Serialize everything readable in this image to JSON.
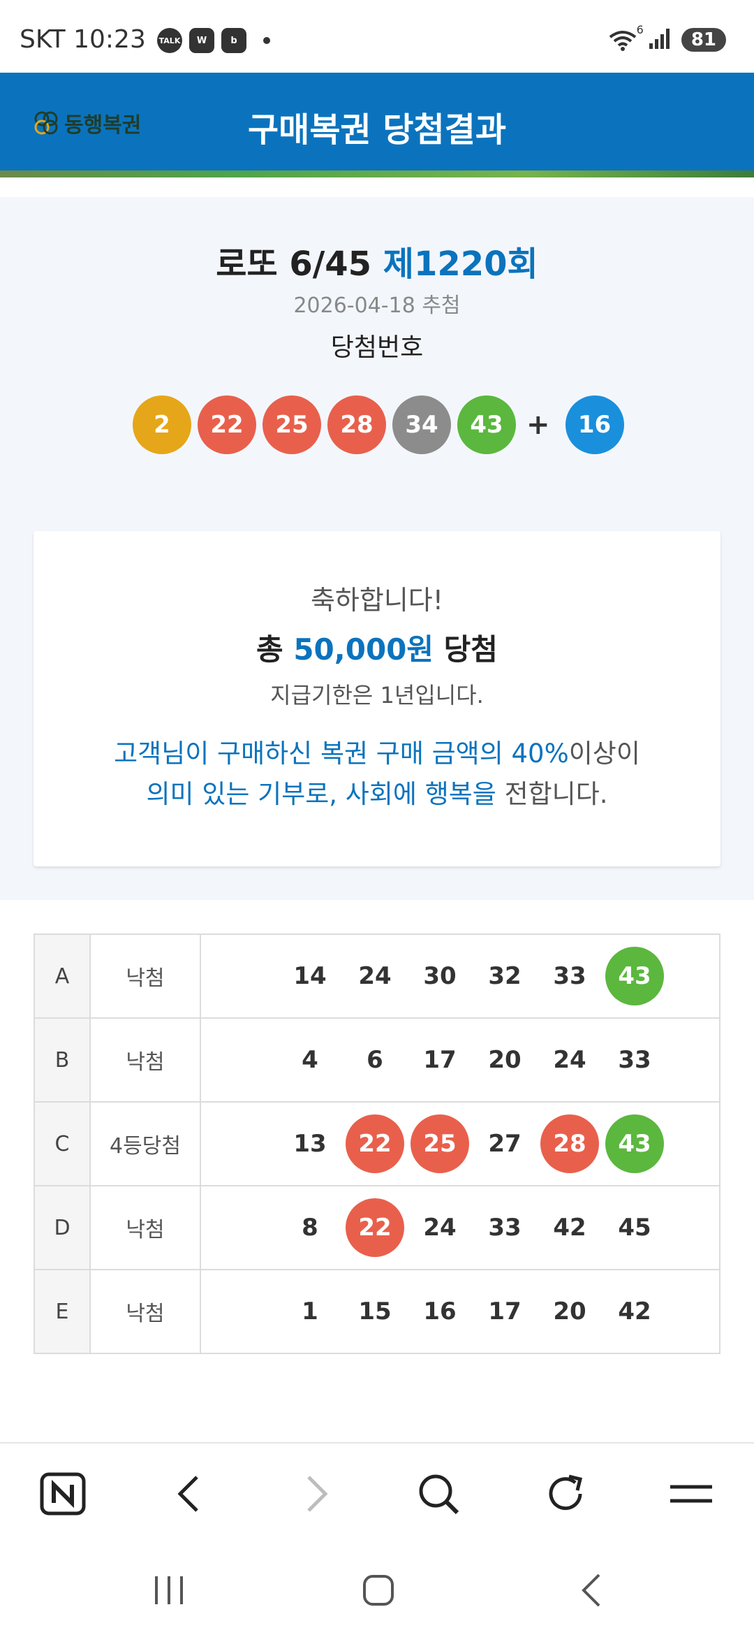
{
  "status_bar": {
    "carrier_time": "SKT 10:23",
    "apps": [
      "TALK",
      "W",
      "b"
    ],
    "wifi_badge": "6",
    "battery": "81"
  },
  "header": {
    "logo_text": "동행복권",
    "title": "구매복권 당첨결과",
    "color": "#0b73bd"
  },
  "draw": {
    "game": "로또 6/45",
    "round": "제1220회",
    "date": "2026-04-18 추첨",
    "numbers_label": "당첨번호",
    "winning_numbers": [
      {
        "value": "2",
        "color": "#e6a619"
      },
      {
        "value": "22",
        "color": "#e8604c"
      },
      {
        "value": "25",
        "color": "#e8604c"
      },
      {
        "value": "28",
        "color": "#e8604c"
      },
      {
        "value": "34",
        "color": "#8c8c8c"
      },
      {
        "value": "43",
        "color": "#5bb73e"
      }
    ],
    "plus": "+",
    "bonus_number": {
      "value": "16",
      "color": "#1a8fdc"
    }
  },
  "result": {
    "congrats": "축하합니다!",
    "prize_prefix": "총 ",
    "prize_amount": "50,000원",
    "prize_suffix": " 당첨",
    "deadline": "지급기한은 1년입니다.",
    "donate_line1_blue": "고객님이 구매하신 복권 구매 금액의 40%",
    "donate_line1_gray": "이상이",
    "donate_line2_blue": "의미 있는 기부로, 사회에 행복을",
    "donate_line2_gray": " 전합니다."
  },
  "ticket": {
    "rows": [
      {
        "line": "A",
        "result": "낙첨",
        "numbers": [
          {
            "value": "14",
            "hit": null
          },
          {
            "value": "24",
            "hit": null
          },
          {
            "value": "30",
            "hit": null
          },
          {
            "value": "32",
            "hit": null
          },
          {
            "value": "33",
            "hit": null
          },
          {
            "value": "43",
            "hit": "#5bb73e"
          }
        ]
      },
      {
        "line": "B",
        "result": "낙첨",
        "numbers": [
          {
            "value": "4",
            "hit": null
          },
          {
            "value": "6",
            "hit": null
          },
          {
            "value": "17",
            "hit": null
          },
          {
            "value": "20",
            "hit": null
          },
          {
            "value": "24",
            "hit": null
          },
          {
            "value": "33",
            "hit": null
          }
        ]
      },
      {
        "line": "C",
        "result": "4등당첨",
        "numbers": [
          {
            "value": "13",
            "hit": null
          },
          {
            "value": "22",
            "hit": "#e8604c"
          },
          {
            "value": "25",
            "hit": "#e8604c"
          },
          {
            "value": "27",
            "hit": null
          },
          {
            "value": "28",
            "hit": "#e8604c"
          },
          {
            "value": "43",
            "hit": "#5bb73e"
          }
        ]
      },
      {
        "line": "D",
        "result": "낙첨",
        "numbers": [
          {
            "value": "8",
            "hit": null
          },
          {
            "value": "22",
            "hit": "#e8604c"
          },
          {
            "value": "24",
            "hit": null
          },
          {
            "value": "33",
            "hit": null
          },
          {
            "value": "42",
            "hit": null
          },
          {
            "value": "45",
            "hit": null
          }
        ]
      },
      {
        "line": "E",
        "result": "낙첨",
        "numbers": [
          {
            "value": "1",
            "hit": null
          },
          {
            "value": "15",
            "hit": null
          },
          {
            "value": "16",
            "hit": null
          },
          {
            "value": "17",
            "hit": null
          },
          {
            "value": "20",
            "hit": null
          },
          {
            "value": "42",
            "hit": null
          }
        ]
      }
    ]
  },
  "browser_toolbar": {
    "icons": [
      "naver-home-icon",
      "back-icon",
      "forward-icon",
      "search-icon",
      "refresh-icon",
      "menu-icon"
    ]
  },
  "system_nav": {
    "icons": [
      "recent-apps-icon",
      "home-icon",
      "back-icon"
    ]
  }
}
